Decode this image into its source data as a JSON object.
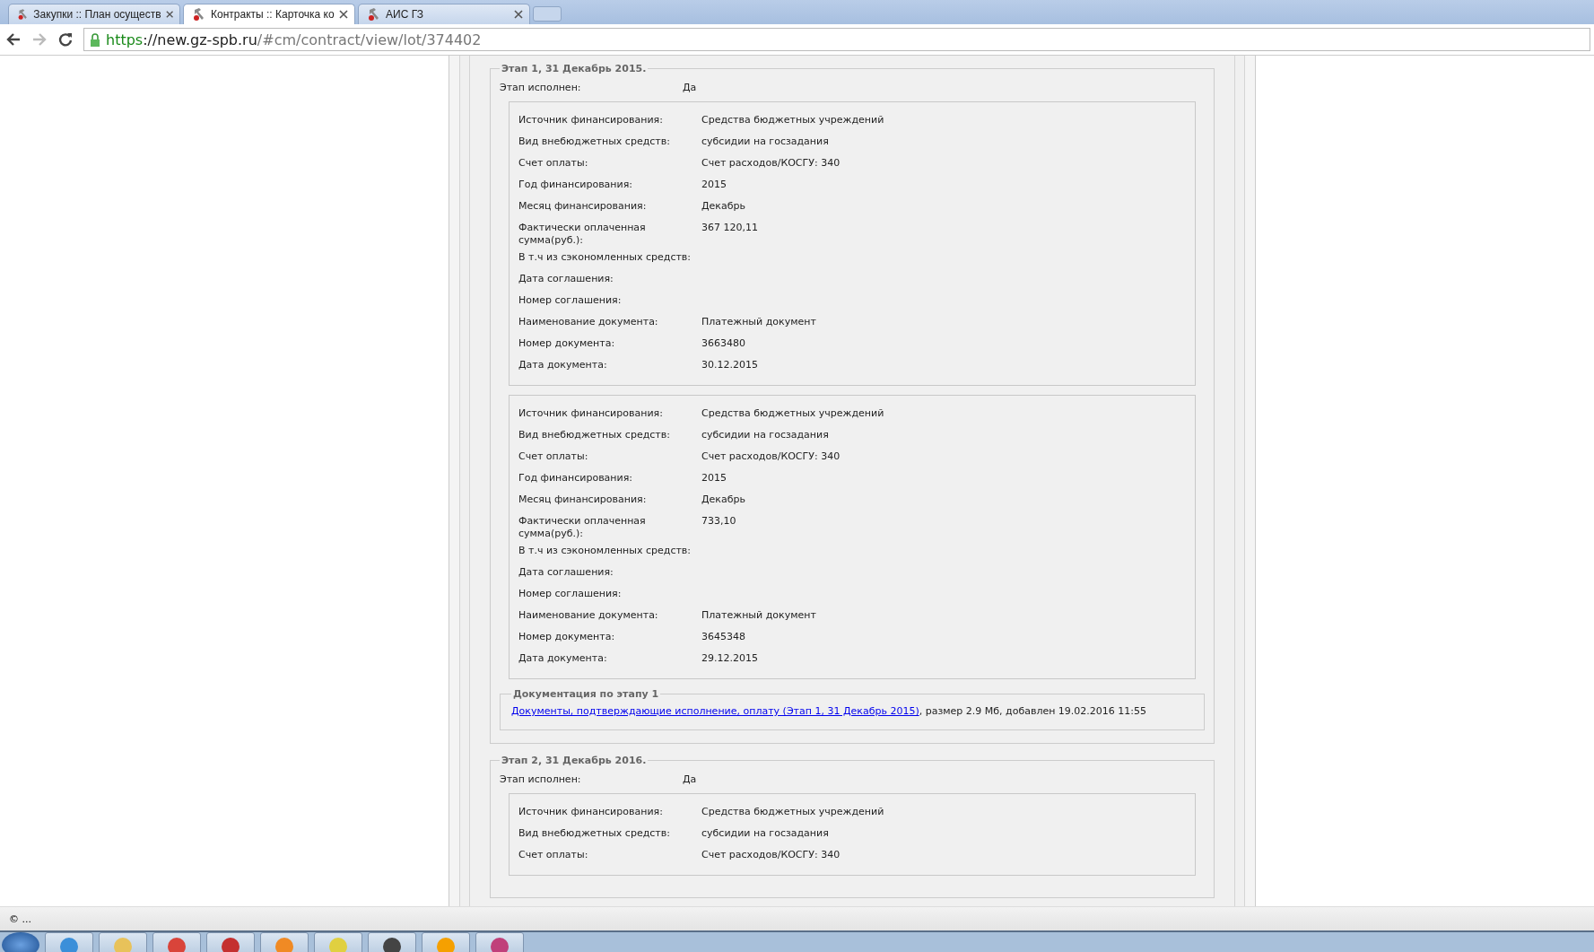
{
  "tabs": [
    {
      "title": "Закупки :: План осуществ",
      "selected": false
    },
    {
      "title": "Контракты :: Карточка ко",
      "selected": true
    },
    {
      "title": "АИС ГЗ",
      "selected": false
    }
  ],
  "address": {
    "scheme": "https",
    "host": "://new.gz-spb.ru",
    "path": "/#cm/contract/view/lot/374402"
  },
  "stages": [
    {
      "legend": "Этап 1, 31 Декабрь 2015.",
      "done_label": "Этап исполнен:",
      "done_value": "Да",
      "payments": [
        {
          "fields": [
            {
              "label": "Источник финансирования:",
              "value": "Средства бюджетных учреждений"
            },
            {
              "label": "Вид внебюджетных средств:",
              "value": "субсидии на госзадания"
            },
            {
              "label": "Счет оплаты:",
              "value": "Счет расходов/КОСГУ: 340"
            },
            {
              "label": "Год финансирования:",
              "value": "2015"
            },
            {
              "label": "Месяц финансирования:",
              "value": "Декабрь"
            },
            {
              "label": "Фактически оплаченная сумма(руб.):",
              "value": "367 120,11"
            },
            {
              "label": "В т.ч из сэкономленных средств:"
            },
            {
              "label": "Дата соглашения:"
            },
            {
              "label": "Номер соглашения:"
            },
            {
              "label": "Наименование документа:",
              "value": "Платежный документ"
            },
            {
              "label": "Номер документа:",
              "value": "3663480"
            },
            {
              "label": "Дата документа:",
              "value": "30.12.2015"
            }
          ]
        },
        {
          "fields": [
            {
              "label": "Источник финансирования:",
              "value": "Средства бюджетных учреждений"
            },
            {
              "label": "Вид внебюджетных средств:",
              "value": "субсидии на госзадания"
            },
            {
              "label": "Счет оплаты:",
              "value": "Счет расходов/КОСГУ: 340"
            },
            {
              "label": "Год финансирования:",
              "value": "2015"
            },
            {
              "label": "Месяц финансирования:",
              "value": "Декабрь"
            },
            {
              "label": "Фактически оплаченная сумма(руб.):",
              "value": "733,10"
            },
            {
              "label": "В т.ч из сэкономленных средств:"
            },
            {
              "label": "Дата соглашения:"
            },
            {
              "label": "Номер соглашения:"
            },
            {
              "label": "Наименование документа:",
              "value": "Платежный документ"
            },
            {
              "label": "Номер документа:",
              "value": "3645348"
            },
            {
              "label": "Дата документа:",
              "value": "29.12.2015"
            }
          ]
        }
      ],
      "documentation": {
        "legend": "Документация по этапу 1",
        "link": "Документы, подтверждающие исполнение, оплату (Этап 1, 31 Декабрь 2015)",
        "suffix": ", размер 2.9 Мб, добавлен 19.02.2016 11:55"
      }
    },
    {
      "legend": "Этап 2, 31 Декабрь 2016.",
      "done_label": "Этап исполнен:",
      "done_value": "Да",
      "payments": [
        {
          "fields": [
            {
              "label": "Источник финансирования:",
              "value": "Средства бюджетных учреждений"
            },
            {
              "label": "Вид внебюджетных средств:",
              "value": "субсидии на госзадания"
            },
            {
              "label": "Счет оплаты:",
              "value": "Счет расходов/КОСГУ: 340"
            }
          ]
        }
      ]
    }
  ],
  "status_text": "© ...",
  "taskbar": [
    {
      "kind": "start"
    },
    {
      "kind": "globe"
    },
    {
      "kind": "folder"
    },
    {
      "kind": "chrome"
    },
    {
      "kind": "hammer"
    },
    {
      "kind": "play"
    },
    {
      "kind": "pencil"
    },
    {
      "kind": "graduate"
    },
    {
      "kind": "orange"
    },
    {
      "kind": "key"
    }
  ]
}
